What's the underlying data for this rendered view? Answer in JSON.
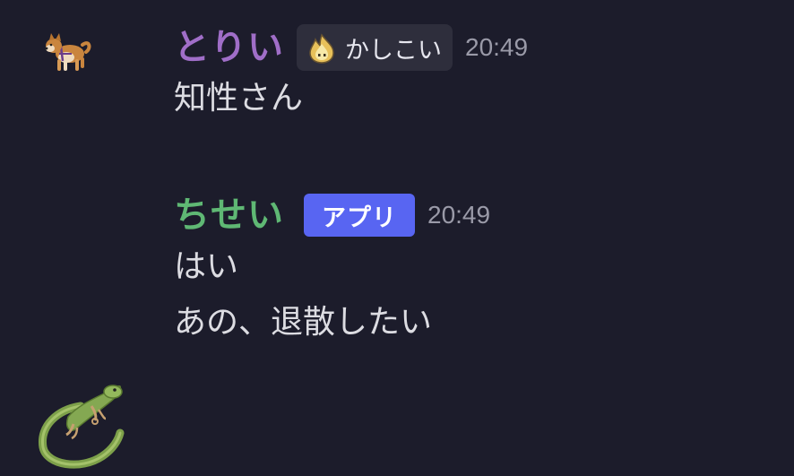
{
  "messages": [
    {
      "username": "とりい",
      "role_tag": "かしこい",
      "role_icon": "flame-sprite-icon",
      "timestamp": "20:49",
      "avatar": "shiba-dog-avatar",
      "lines": [
        "知性さん"
      ]
    },
    {
      "username": "ちせい",
      "app_badge": "アプリ",
      "timestamp": "20:49",
      "avatar": "lizard-avatar",
      "lines": [
        "はい",
        "あの、退散したい"
      ]
    }
  ],
  "colors": {
    "background": "#1c1c2b",
    "username_1": "#a06ec8",
    "username_2": "#5fb874",
    "app_badge": "#5865f2",
    "role_tag_bg": "#2e2e3c",
    "timestamp": "#9a9aa8",
    "message_text": "#dcdce2"
  }
}
